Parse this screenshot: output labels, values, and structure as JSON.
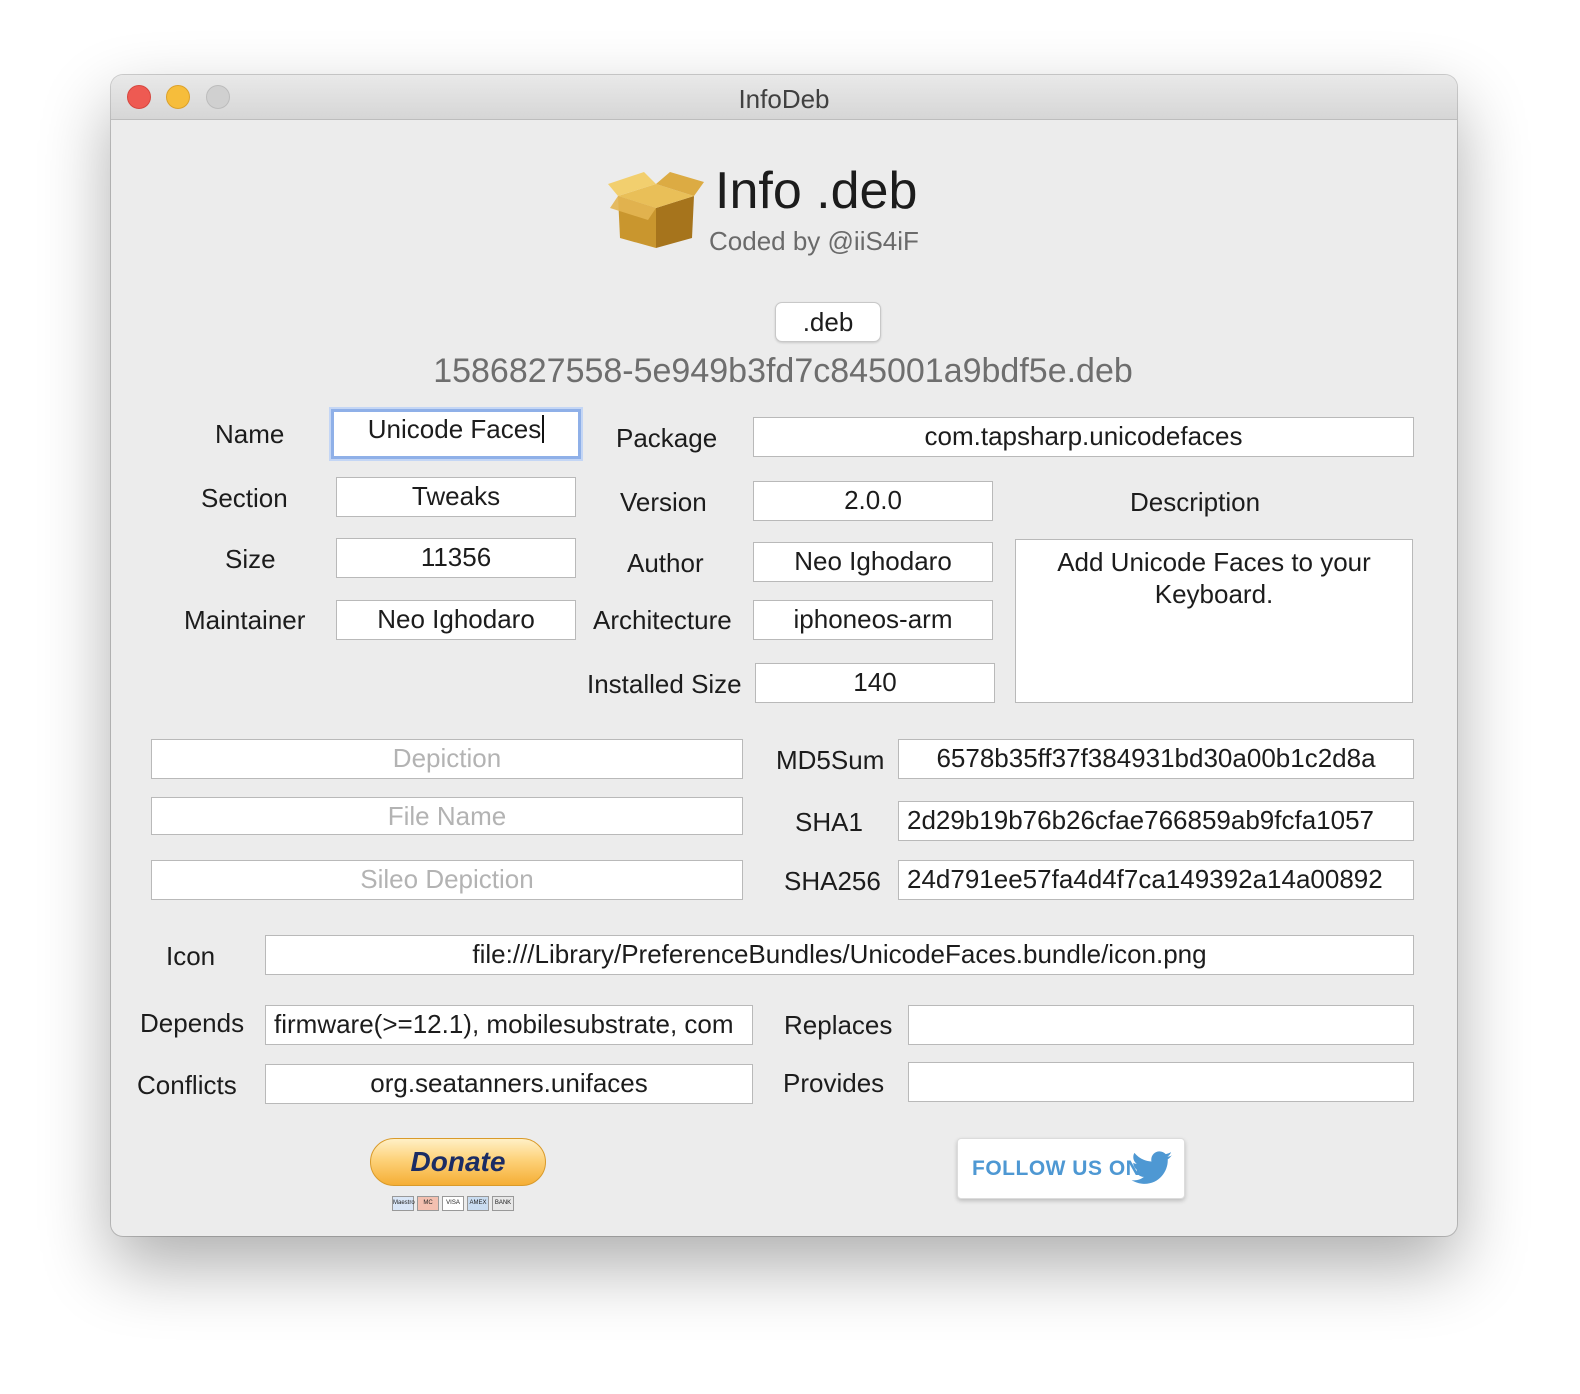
{
  "window": {
    "title": "InfoDeb"
  },
  "header": {
    "app_title": "Info .deb",
    "subtitle": "Coded by @iiS4iF"
  },
  "deb_button": ".deb",
  "file_name": "1586827558-5e949b3fd7c845001a9bdf5e.deb",
  "fields": {
    "name": {
      "label": "Name",
      "value": "Unicode Faces"
    },
    "package": {
      "label": "Package",
      "value": "com.tapsharp.unicodefaces"
    },
    "section": {
      "label": "Section",
      "value": "Tweaks"
    },
    "version": {
      "label": "Version",
      "value": "2.0.0"
    },
    "size": {
      "label": "Size",
      "value": "11356"
    },
    "author": {
      "label": "Author",
      "value": "Neo Ighodaro"
    },
    "maintainer": {
      "label": "Maintainer",
      "value": "Neo Ighodaro"
    },
    "architecture": {
      "label": "Architecture",
      "value": "iphoneos-arm"
    },
    "installed_size": {
      "label": "Installed Size",
      "value": "140"
    },
    "description": {
      "label": "Description",
      "value": "Add Unicode Faces to your Keyboard."
    },
    "depiction": {
      "placeholder": "Depiction",
      "value": ""
    },
    "file_name_field": {
      "placeholder": "File Name",
      "value": ""
    },
    "sileo_depiction": {
      "placeholder": "Sileo Depiction",
      "value": ""
    },
    "md5sum": {
      "label": "MD5Sum",
      "value": "6578b35ff37f384931bd30a00b1c2d8a"
    },
    "sha1": {
      "label": "SHA1",
      "value": "2d29b19b76b26cfae766859ab9fcfa1057"
    },
    "sha256": {
      "label": "SHA256",
      "value": "24d791ee57fa4d4f7ca149392a14a00892"
    },
    "icon": {
      "label": "Icon",
      "value": "file:///Library/PreferenceBundles/UnicodeFaces.bundle/icon.png"
    },
    "depends": {
      "label": "Depends",
      "value": "firmware(>=12.1), mobilesubstrate, com"
    },
    "replaces": {
      "label": "Replaces",
      "value": ""
    },
    "conflicts": {
      "label": "Conflicts",
      "value": "org.seatanners.unifaces"
    },
    "provides": {
      "label": "Provides",
      "value": ""
    }
  },
  "donate": {
    "label": "Donate",
    "cards": [
      "Maestro",
      "MC",
      "VISA",
      "AMEX",
      "BANK"
    ]
  },
  "twitter": {
    "label": "FOLLOW US ON"
  },
  "colors": {
    "accent_focus": "#8fb0e8",
    "twitter_blue": "#4e98d3",
    "donate_gold": "#f5ae35"
  }
}
